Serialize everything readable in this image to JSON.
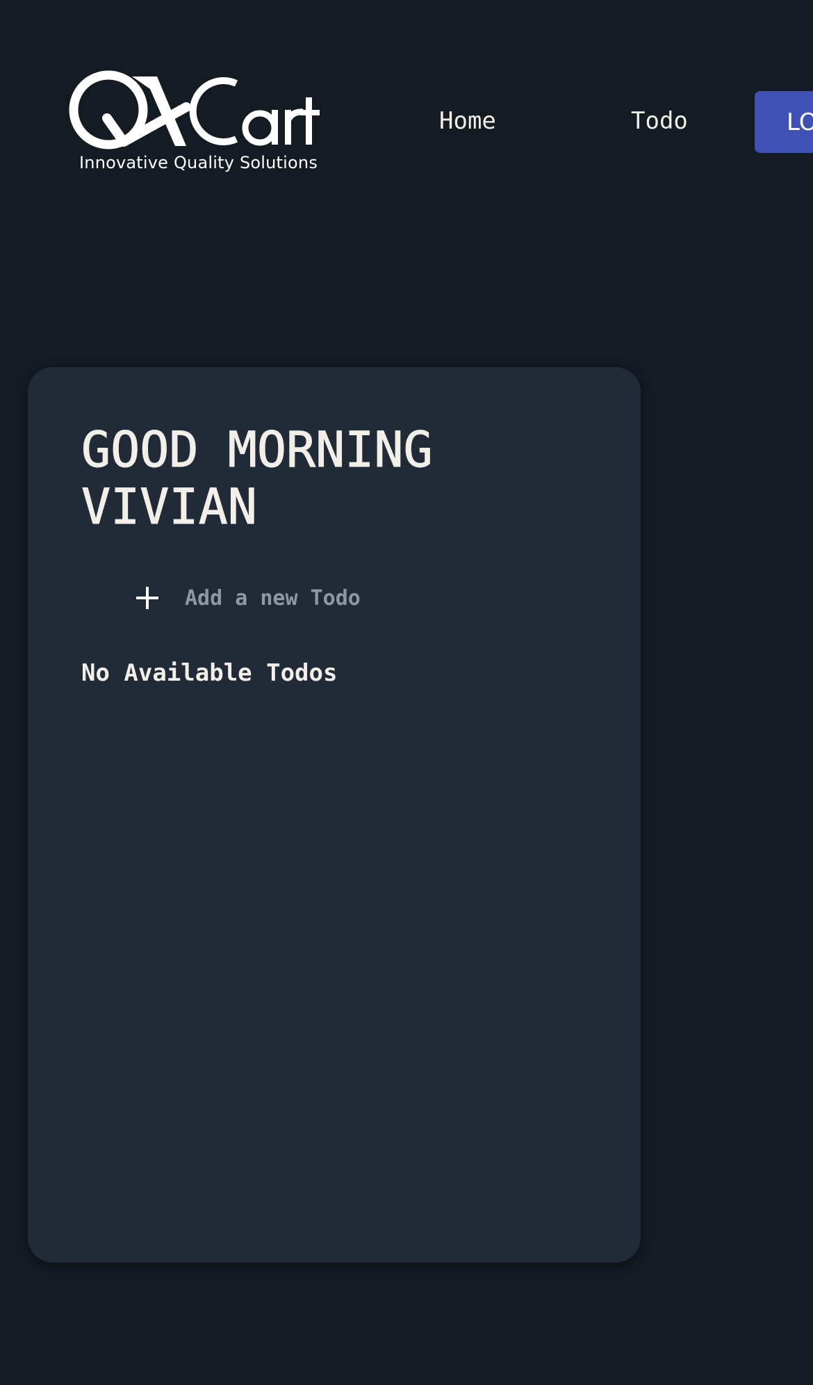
{
  "header": {
    "logo": {
      "brand": "QACart",
      "tagline": "Innovative Quality Solutions"
    },
    "nav": {
      "home_label": "Home",
      "todo_label": "Todo",
      "logout_label": "LOGOUT"
    }
  },
  "main": {
    "greeting": "GOOD MORNING VIVIAN",
    "new_todo": {
      "placeholder": "Add a new Todo",
      "value": ""
    },
    "empty_message": "No Available Todos"
  },
  "colors": {
    "page_background": "#151b23",
    "card_background": "#212b37",
    "text_primary": "#f1efe8",
    "placeholder_text": "#8e97a4",
    "accent_button": "#3f51b5"
  }
}
